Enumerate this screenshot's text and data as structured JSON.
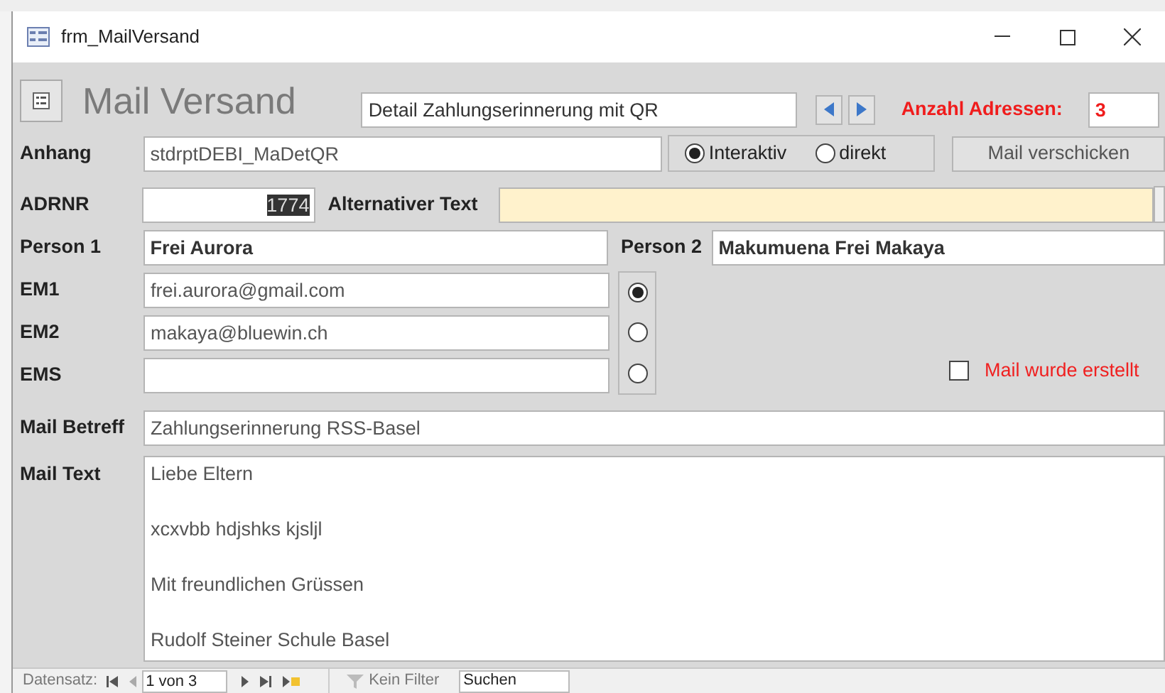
{
  "window": {
    "title": "frm_MailVersand"
  },
  "header": {
    "title": "Mail Versand",
    "report": "Detail Zahlungserinnerung mit QR",
    "count_label": "Anzahl Adressen:",
    "count": "3"
  },
  "anhang": {
    "label": "Anhang",
    "value": "stdrptDEBI_MaDetQR",
    "modes": [
      {
        "label": "Interaktiv",
        "selected": true
      },
      {
        "label": "direkt",
        "selected": false
      }
    ],
    "send_button": "Mail verschicken"
  },
  "adrnr": {
    "label": "ADRNR",
    "value": "1774",
    "text_selected": true,
    "alt_label": "Alternativer Text"
  },
  "persons": [
    {
      "label": "Person 1",
      "value": "Frei Aurora"
    },
    {
      "label": "Person 2",
      "value": "Makumuena Frei Makaya"
    }
  ],
  "emails": [
    {
      "label": "EM1",
      "value": "frei.aurora@gmail.com",
      "selected": true
    },
    {
      "label": "EM2",
      "value": "makaya@bluewin.ch",
      "selected": false
    },
    {
      "label": "EMS",
      "selected": false
    }
  ],
  "mail_created": {
    "label": "Mail wurde erstellt",
    "checked": false
  },
  "subject": {
    "label": "Mail Betreff",
    "value": "Zahlungserinnerung RSS-Basel"
  },
  "body": {
    "label": "Mail Text",
    "lines": [
      "Liebe Eltern",
      "xcxvbb hdjshks kjsljl",
      "Mit freundlichen Grüssen",
      "Rudolf Steiner Schule Basel"
    ]
  },
  "navigation": {
    "label": "Datensatz:",
    "position": "1 von 3",
    "filter": "Kein Filter",
    "search_placeholder": "Suchen"
  }
}
